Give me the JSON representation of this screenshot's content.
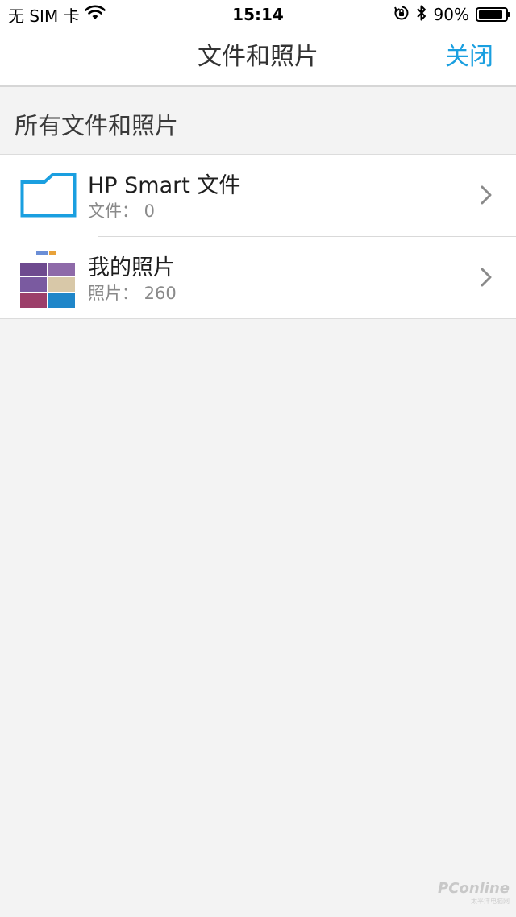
{
  "status_bar": {
    "carrier": "无 SIM 卡",
    "time": "15:14",
    "battery_percent": "90%",
    "battery_level": 0.9,
    "icons": [
      "wifi-icon",
      "orientation-lock-icon",
      "bluetooth-icon",
      "battery-icon"
    ]
  },
  "nav": {
    "title": "文件和照片",
    "close_label": "关闭",
    "accent_color": "#1a9fe0"
  },
  "section": {
    "title": "所有文件和照片"
  },
  "items": [
    {
      "icon": "folder-icon",
      "title": "HP Smart 文件",
      "subtitle": "文件： 0"
    },
    {
      "icon": "photo-thumbnail",
      "title": "我的照片",
      "subtitle": "照片： 260"
    }
  ],
  "watermark": {
    "logo": "PConline",
    "sub": "太平洋电脑网"
  }
}
